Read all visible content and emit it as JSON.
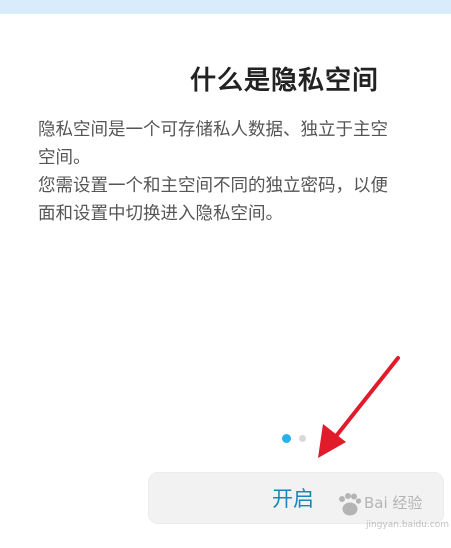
{
  "page": {
    "title": "什么是隐私空间",
    "description_lines": [
      "隐私空间是一个可存储私人数据、独立于主空",
      "空间。",
      "您需设置一个和主空间不同的独立密码，以便",
      "面和设置中切换进入隐私空间。"
    ]
  },
  "pager": {
    "current_page": 1,
    "total_pages": 2
  },
  "actions": {
    "start_label": "开启"
  },
  "annotation": {
    "arrow_color": "#e21b2a"
  },
  "watermark": {
    "brand": "Bai 经验",
    "url": "jingyan.baidu.com"
  },
  "colors": {
    "accent": "#1a87b9",
    "dot_active": "#2ab0e8"
  }
}
